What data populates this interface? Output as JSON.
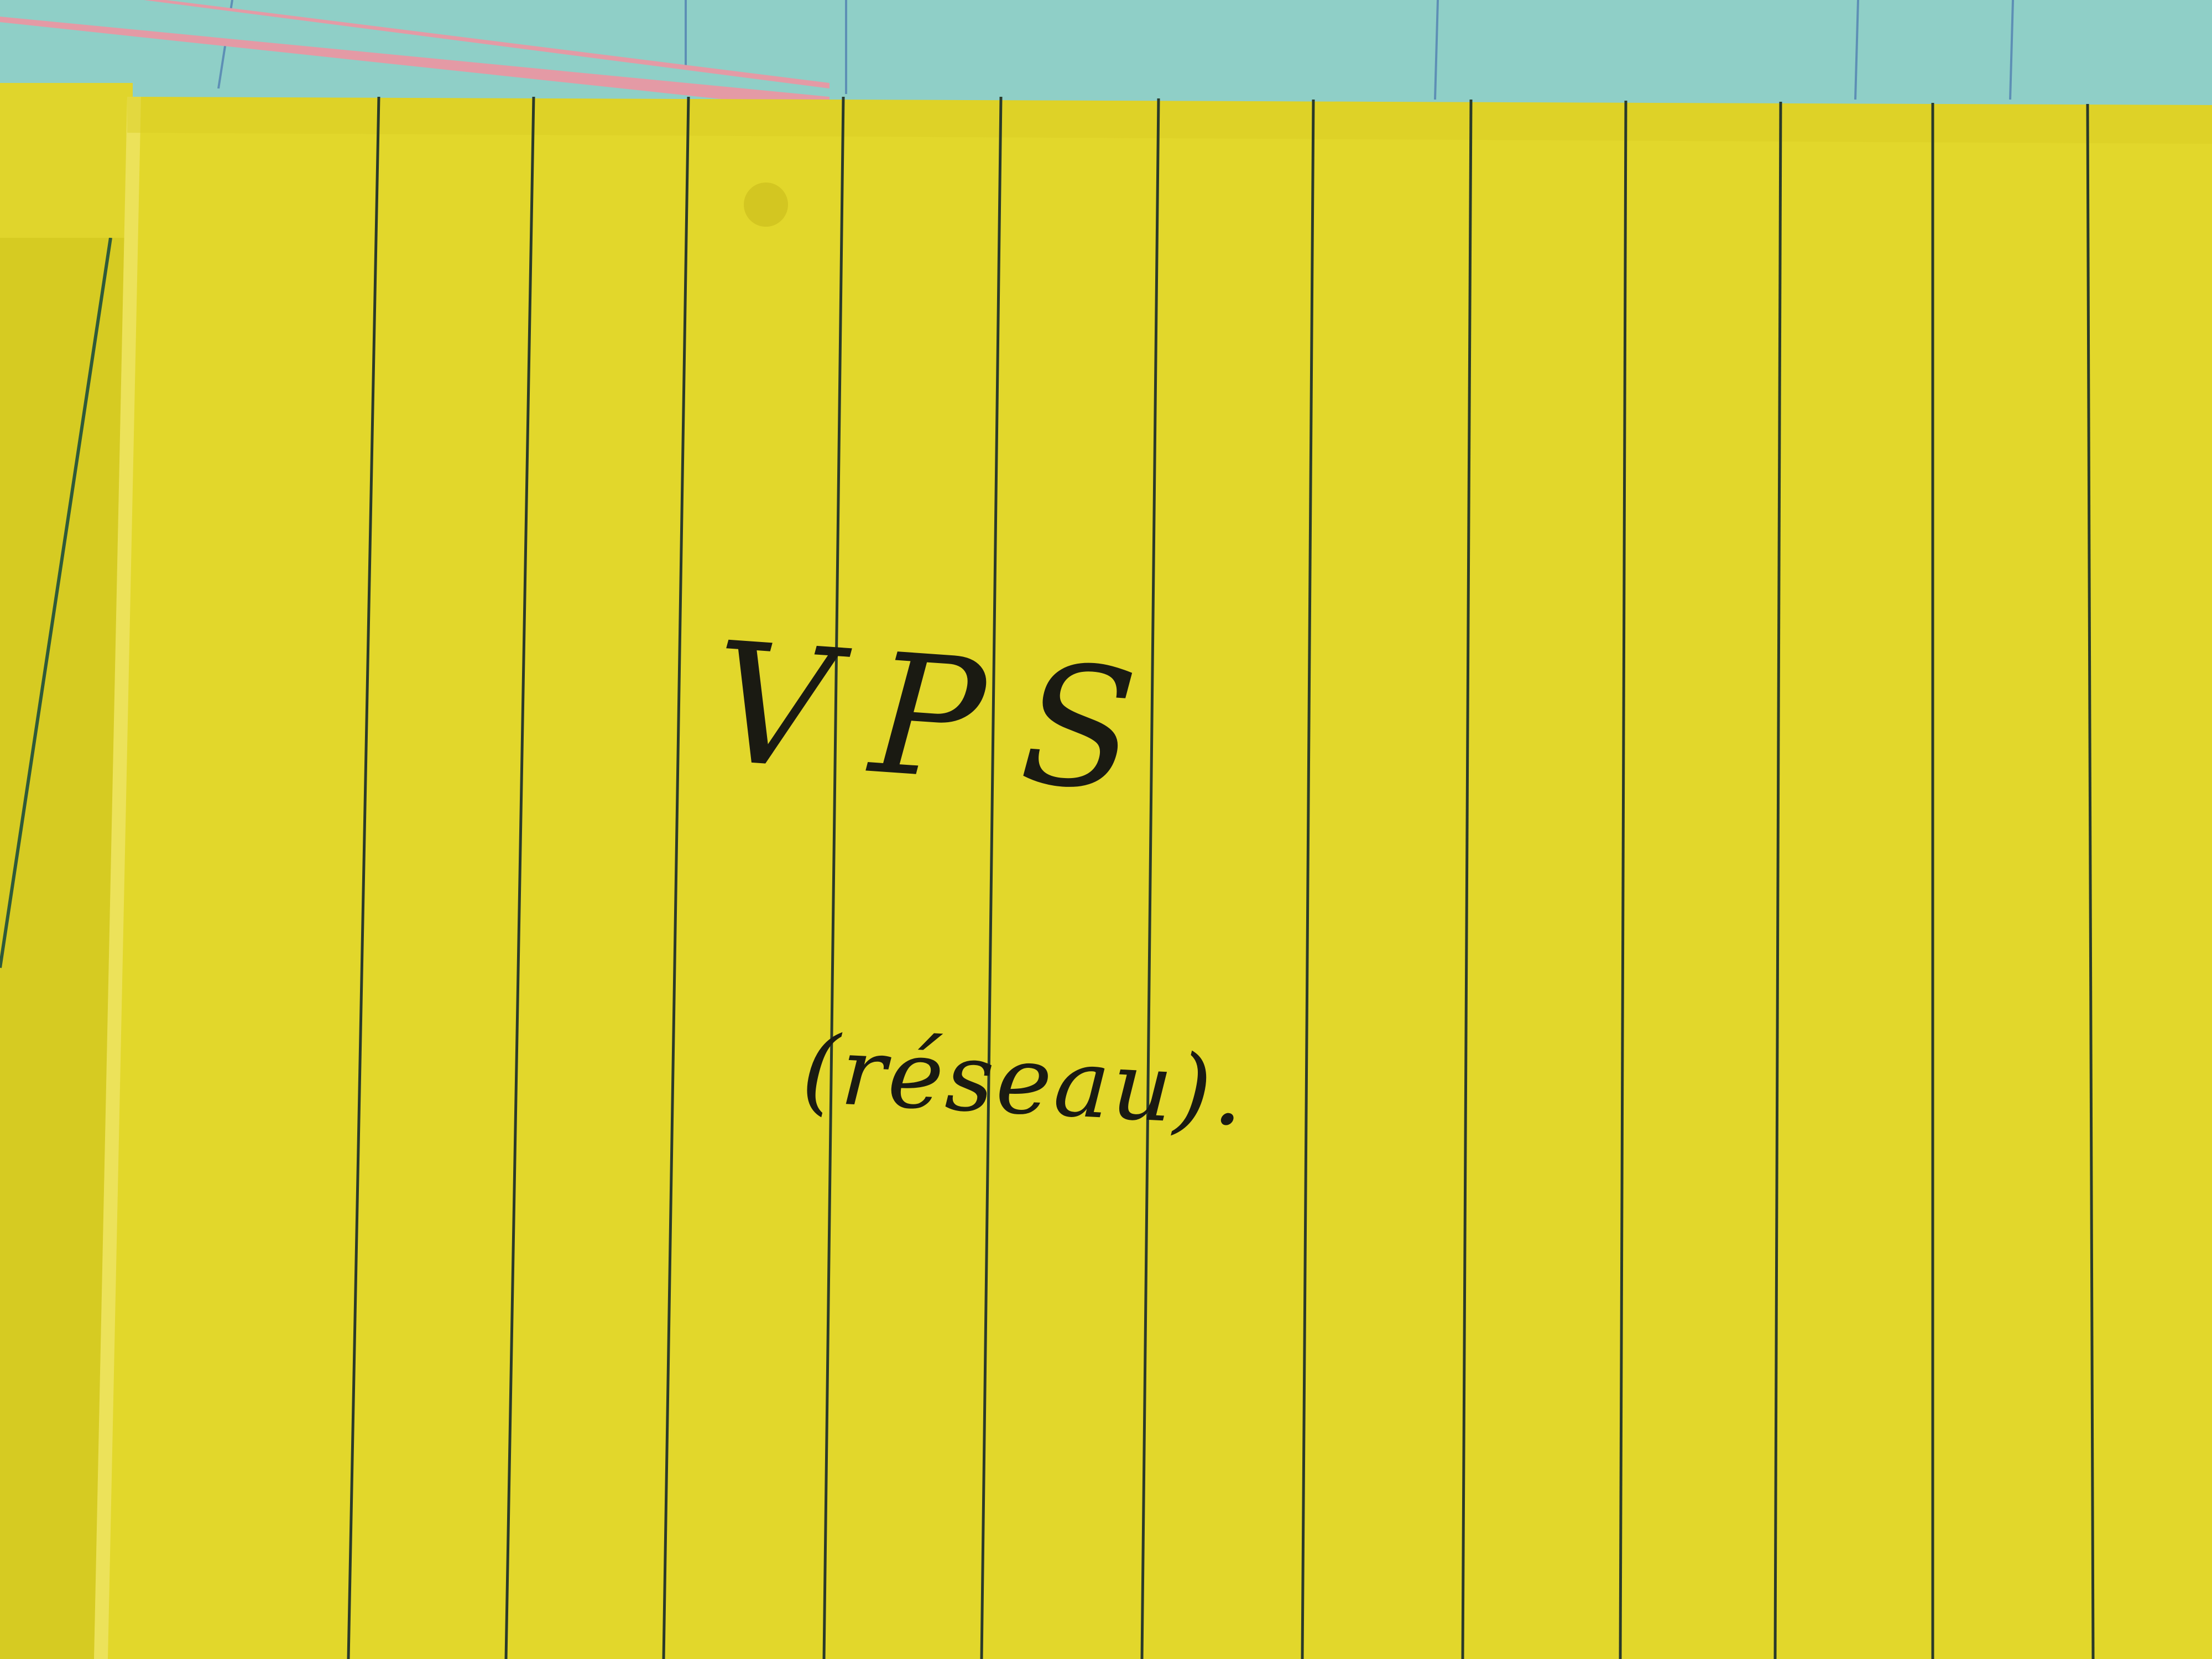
{
  "card": {
    "title": "VPS",
    "subtitle": "(réseau)."
  },
  "colors": {
    "card_yellow": "#e2d72b",
    "card_yellow_shadow": "#cfc21d",
    "back_card_cyan": "#8fcfc7",
    "back_card_pink": "#e49aa5",
    "ruling_line": "#2a3a2a",
    "ink": "#1a1a12"
  }
}
